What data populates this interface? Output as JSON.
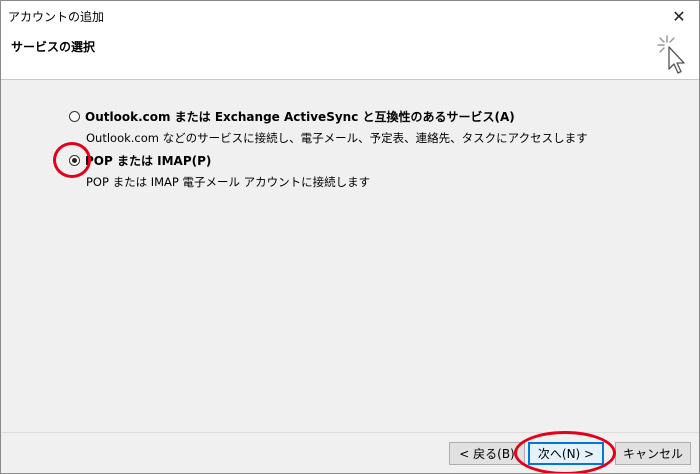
{
  "window": {
    "title": "アカウントの追加",
    "close_glyph": "✕"
  },
  "header": {
    "heading": "サービスの選択",
    "icon": "wizard-cursor-icon"
  },
  "options": [
    {
      "label": "Outlook.com または Exchange ActiveSync と互換性のあるサービス(A)",
      "description": "Outlook.com などのサービスに接続し、電子メール、予定表、連絡先、タスクにアクセスします",
      "selected": false
    },
    {
      "label": "POP または IMAP(P)",
      "description": "POP または IMAP 電子メール アカウントに接続します",
      "selected": true
    }
  ],
  "buttons": {
    "back": "< 戻る(B)",
    "next": "次へ(N) >",
    "cancel": "キャンセル"
  },
  "colors": {
    "annotation": "#e3001b",
    "default_button_border": "#0078d7"
  }
}
